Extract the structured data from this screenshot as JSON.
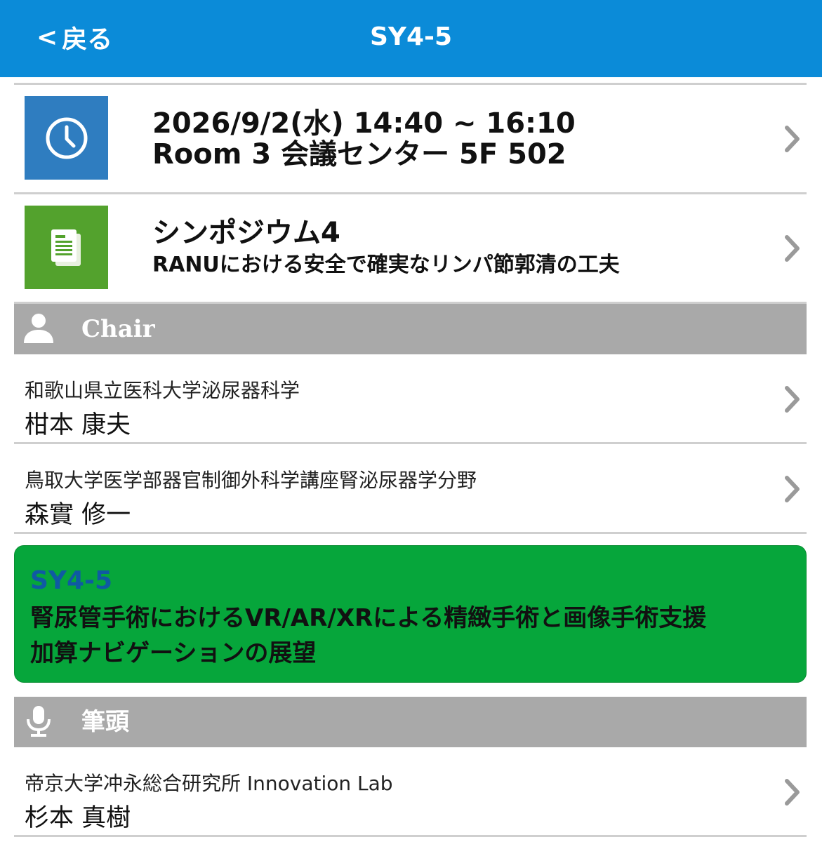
{
  "nav": {
    "back_chevron": "<",
    "back_label": "戻る",
    "title": "SY4-5",
    "bg_color": "#0b8bd8"
  },
  "session": {
    "icon": "clock-icon",
    "datetime": "2026/9/2(水) 14:40 ~ 16:10",
    "room": "Room 3 会議センター 5F 502"
  },
  "program": {
    "icon": "document-icon",
    "title": "シンポジウム4",
    "subtitle": "RANUにおける安全で確実なリンパ節郭清の工夫"
  },
  "chair_section": {
    "icon": "person-icon",
    "label": "Chair",
    "people": [
      {
        "affiliation": "和歌山県立医科大学泌尿器科学",
        "name": "柑本 康夫"
      },
      {
        "affiliation": "鳥取大学医学部器官制御外科学講座腎泌尿器学分野",
        "name": "森實 修一"
      }
    ]
  },
  "abstract": {
    "code": "SY4-5",
    "title_line1": "腎尿管手術におけるVR/AR/XRによる精緻手術と画像手術支援",
    "title_line2": "加算ナビゲーションの展望",
    "bg_color": "#06a63b"
  },
  "presenter_section": {
    "icon": "microphone-icon",
    "label": "筆頭",
    "people": [
      {
        "affiliation": "帝京大学冲永総合研究所 Innovation Lab",
        "name": "杉本 真樹"
      }
    ]
  }
}
